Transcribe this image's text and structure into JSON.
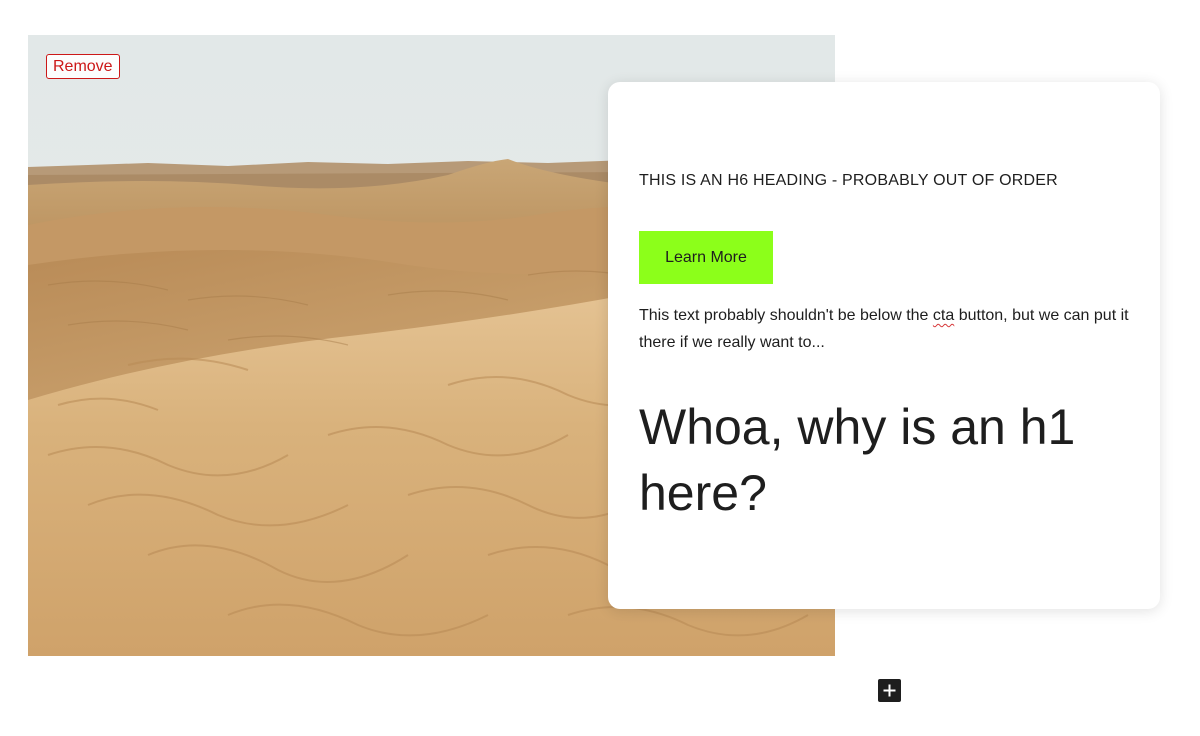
{
  "image_block": {
    "remove_label": "Remove",
    "icon": "desert-dunes-photo"
  },
  "card": {
    "h6": "This is an h6 heading - probably out of order",
    "cta_label": "Learn More",
    "paragraph_before": "This text probably shouldn't be below the ",
    "paragraph_misspelled": "cta",
    "paragraph_after": " button, but we can put it there if we really want to...",
    "h1": "Whoa, why is an h1 here?"
  },
  "add_block": {
    "icon": "plus-icon"
  },
  "colors": {
    "remove_red": "#cc1818",
    "cta_green": "#8cff1a",
    "text_dark": "#1e1e1e"
  }
}
